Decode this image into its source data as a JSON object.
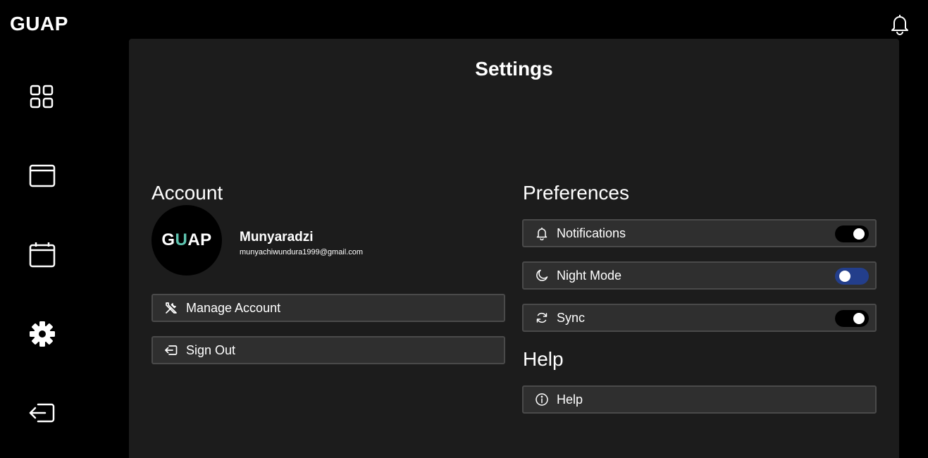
{
  "app": {
    "brand": "GUAP"
  },
  "header": {
    "notification_icon": "bell-icon"
  },
  "sidebar": {
    "items": [
      {
        "name": "dashboard",
        "icon": "grid-icon"
      },
      {
        "name": "window",
        "icon": "browser-window-icon"
      },
      {
        "name": "calendar",
        "icon": "calendar-icon"
      },
      {
        "name": "settings",
        "icon": "gear-icon"
      },
      {
        "name": "logout",
        "icon": "logout-icon"
      }
    ]
  },
  "page": {
    "title": "Settings"
  },
  "account": {
    "heading": "Account",
    "avatar_text_before": "G",
    "avatar_text_accent": "U",
    "avatar_text_after": "AP",
    "accent_color": "#5ec4b0",
    "name": "Munyaradzi",
    "email": "munyachiwundura1999@gmail.com",
    "manage_label": "Manage Account",
    "signout_label": "Sign Out"
  },
  "preferences": {
    "heading": "Preferences",
    "items": [
      {
        "label": "Notifications",
        "icon": "bell-icon",
        "enabled": true
      },
      {
        "label": "Night Mode",
        "icon": "moon-icon",
        "enabled": false
      },
      {
        "label": "Sync",
        "icon": "sync-icon",
        "enabled": true
      }
    ],
    "toggle_off_color": "#233e8b"
  },
  "help": {
    "heading": "Help",
    "label": "Help"
  }
}
